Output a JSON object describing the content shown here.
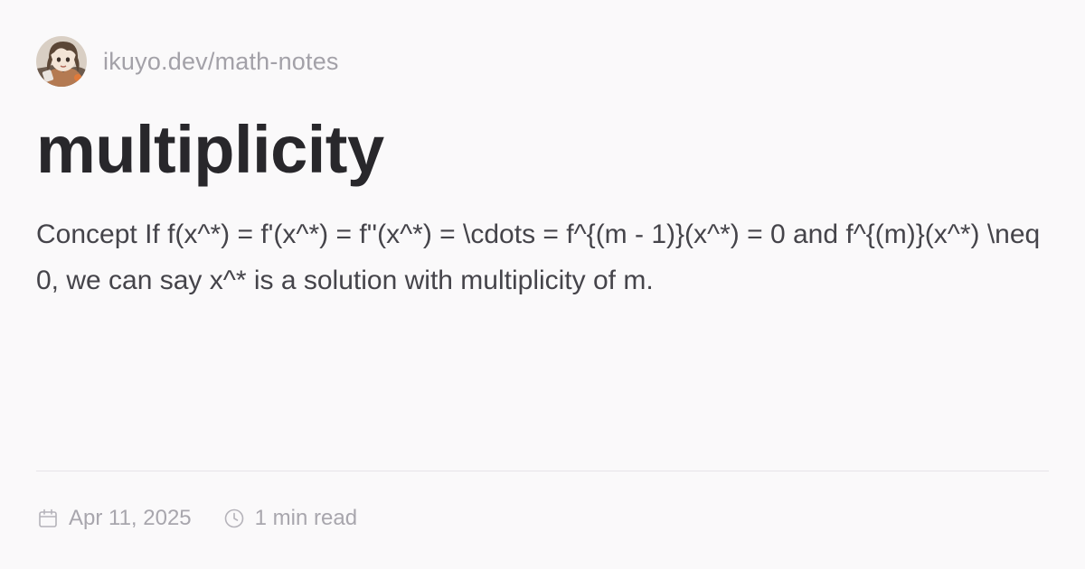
{
  "site": {
    "url": "ikuyo.dev/math-notes",
    "avatar_icon": "anime-avatar-icon"
  },
  "post": {
    "title": "multiplicity",
    "description": "Concept If f(x^*) = f'(x^*) = f''(x^*) = \\cdots = f^{(m - 1)}(x^*) = 0 and f^{(m)}(x^*) \\neq 0, we can say x^* is a solution with multiplicity of m."
  },
  "meta": {
    "date": "Apr 11, 2025",
    "date_icon": "calendar-icon",
    "read_time": "1 min read",
    "read_time_icon": "clock-icon"
  },
  "colors": {
    "background": "#faf9fa",
    "title": "#28272b",
    "body_text": "#45444a",
    "muted_text": "#a3a1a8",
    "divider": "#e6e4e8"
  }
}
